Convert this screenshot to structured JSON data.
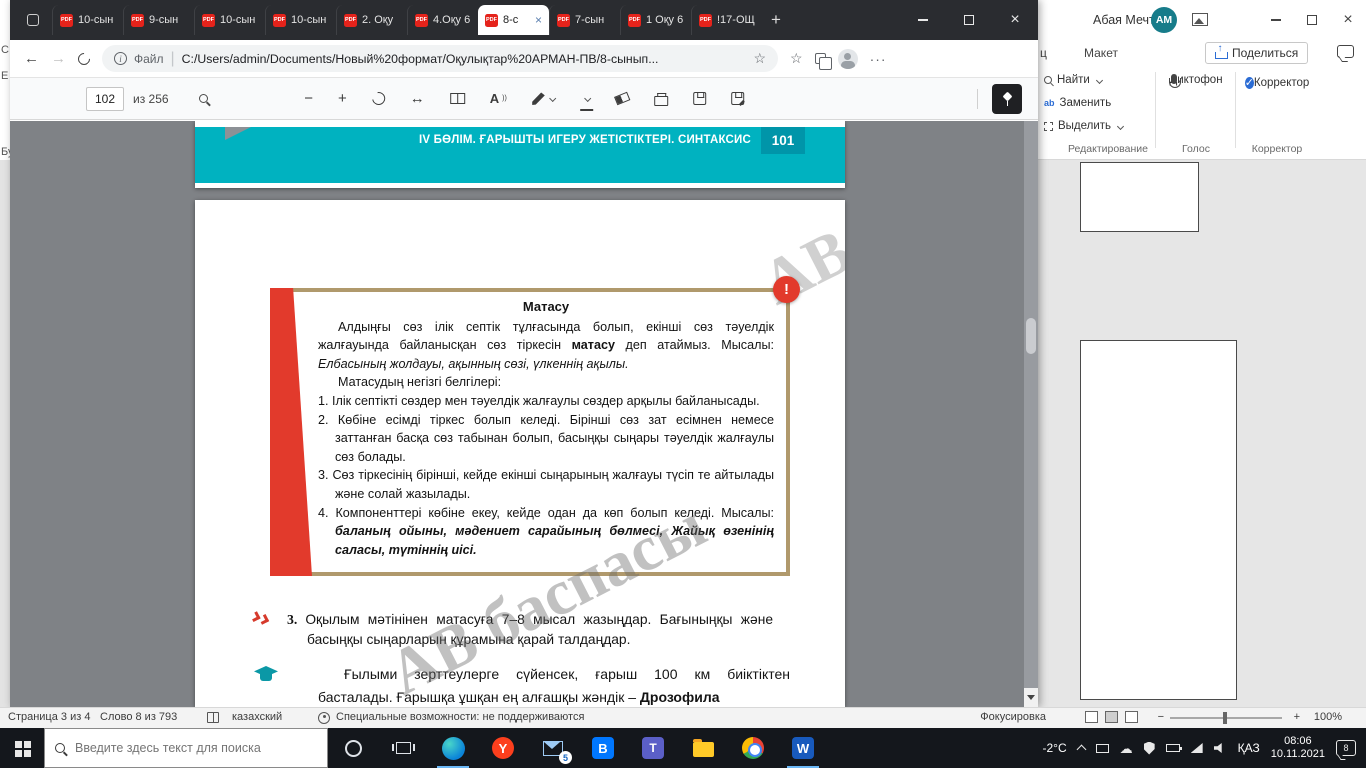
{
  "background_strip": {
    "fragments": [
      "С",
      "Е",
      "Буф"
    ]
  },
  "edge": {
    "tabs": [
      {
        "label": "10-сын"
      },
      {
        "label": "9-сын"
      },
      {
        "label": "10-сын"
      },
      {
        "label": "10-сын"
      },
      {
        "label": "2. Оқу"
      },
      {
        "label": "4.Оқу 6"
      },
      {
        "label": "8-с"
      },
      {
        "label": "7-сын"
      },
      {
        "label": "1 Оқу 6"
      },
      {
        "label": "!17-ОЩ"
      }
    ],
    "address_bar": {
      "scheme_label": "Файл",
      "url": "C:/Users/admin/Documents/Новый%20формат/Оқулықтар%20АРМАН-ПВ/8-сынып..."
    },
    "pdf_toolbar": {
      "page_input": "102",
      "page_total": "из 256"
    }
  },
  "pdf": {
    "header_band": {
      "title": "IV БӨЛІМ. ҒАРЫШТЫ ИГЕРУ ЖЕТІСТІКТЕРІ. СИНТАКСИС",
      "page_number": "101"
    },
    "rule_box": {
      "alert_mark": "!",
      "title": "Матасу",
      "intro_1": "Алдыңғы сөз ілік септік тұлғасында болып, екінші сөз тәуелдік жалғауында байланысқан сөз тіркесін ",
      "intro_term": "матасу",
      "intro_2": " деп атаймыз. Мысалы: ",
      "intro_example": "Елбасының жолдауы, ақынның сөзі, үлкеннің ақылы.",
      "features_label": "Матасудың негізгі белгілері:",
      "items": [
        {
          "num": "1.",
          "text": "Ілік септікті сөздер мен тәуелдік жалғаулы сөздер арқылы байланысады."
        },
        {
          "num": "2.",
          "text": "Көбіне есімді тіркес болып келеді. Бірінші сөз зат есімнен немесе заттанған басқа сөз табынан болып, басыңқы сыңары тәуелдік жалғаулы сөз болады."
        },
        {
          "num": "3.",
          "text": "Сөз тіркесінің бірінші, кейде екінші сыңарының жалғауы түсіп те айтылады және солай жазылады."
        },
        {
          "num": "4.",
          "text": "Компоненттері көбіне екеу, кейде одан да көп болып келеді. Мысалы: ",
          "example": "баланың ойыны, мәдениет сарайының бөлмесі, Жайық өзенінің саласы, түтіннің иісі."
        }
      ]
    },
    "exercise": {
      "number": "3.",
      "text": "Оқылым мәтінінен матасуға 7–8 мысал жазыңдар. Бағыныңқы және басыңқы сыңарларын құрамына қарай талдаңдар."
    },
    "reading": {
      "text": "Ғылыми зерттеулерге сүйенсек, ғарыш 100 км биіктіктен басталады. Ғарышқа ұшқан ең алғашқы жәндік – ",
      "term": "Дрозофила"
    },
    "watermark": "АВ баспасы"
  },
  "word": {
    "titlebar": {
      "user_name": "Абая Мечта",
      "avatar_initials": "АМ"
    },
    "ribbon": {
      "tab_fragment": "ц",
      "tab_layout": "Макет",
      "share": "Поделиться",
      "find": "Найти",
      "replace": "Заменить",
      "select": "Выделить",
      "dictate": "Диктофон",
      "editor": "Корректор",
      "group_editing": "Редактирование",
      "group_voice": "Голос",
      "group_editor": "Корректор"
    },
    "status_bar": {
      "page": "Страница 3 из 4",
      "words": "Слово 8 из 793",
      "language": "казахский",
      "accessibility": "Специальные возможности: не поддерживаются",
      "focus": "Фокусировка",
      "zoom": "100%"
    }
  },
  "taskbar": {
    "search_placeholder": "Введите здесь текст для поиска",
    "weather": "-2°C",
    "mail_badge": "5",
    "language": "ҚАЗ",
    "time": "08:06",
    "date": "10.11.2021",
    "notifications_badge": "8"
  },
  "colors": {
    "teal_band": "#00b2c0",
    "teal_dark": "#0095a9",
    "accent_red": "#e23a2c",
    "box_border": "#b0996c",
    "word_blue": "#185abd",
    "taskbar_bg": "#14171c"
  }
}
